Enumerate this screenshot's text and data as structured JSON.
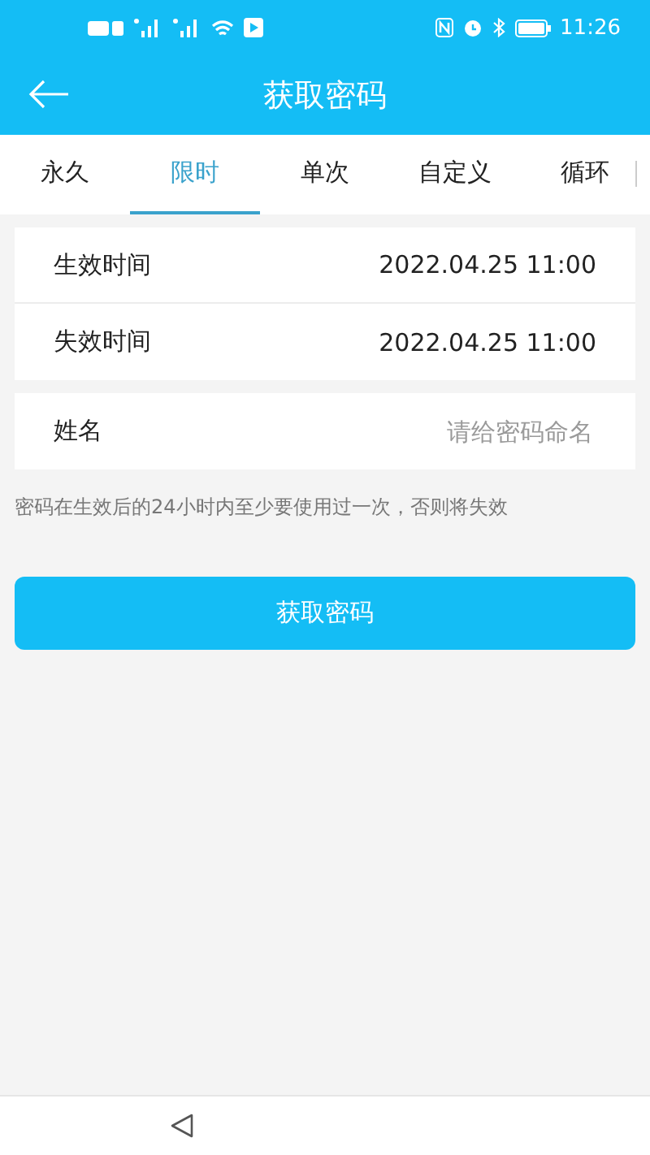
{
  "status_bar": {
    "time": "11:26"
  },
  "header": {
    "title": "获取密码"
  },
  "tabs": [
    {
      "label": "永久",
      "selected": false
    },
    {
      "label": "限时",
      "selected": true
    },
    {
      "label": "单次",
      "selected": false
    },
    {
      "label": "自定义",
      "selected": false
    },
    {
      "label": "循环",
      "selected": false
    }
  ],
  "time_rows": [
    {
      "label": "生效时间",
      "value": "2022.04.25 11:00"
    },
    {
      "label": "失效时间",
      "value": "2022.04.25 11:00"
    }
  ],
  "name_field": {
    "label": "姓名",
    "placeholder": "请给密码命名"
  },
  "note": "密码在生效后的24小时内至少要使用过一次，否则将失效",
  "submit_button": "获取密码"
}
